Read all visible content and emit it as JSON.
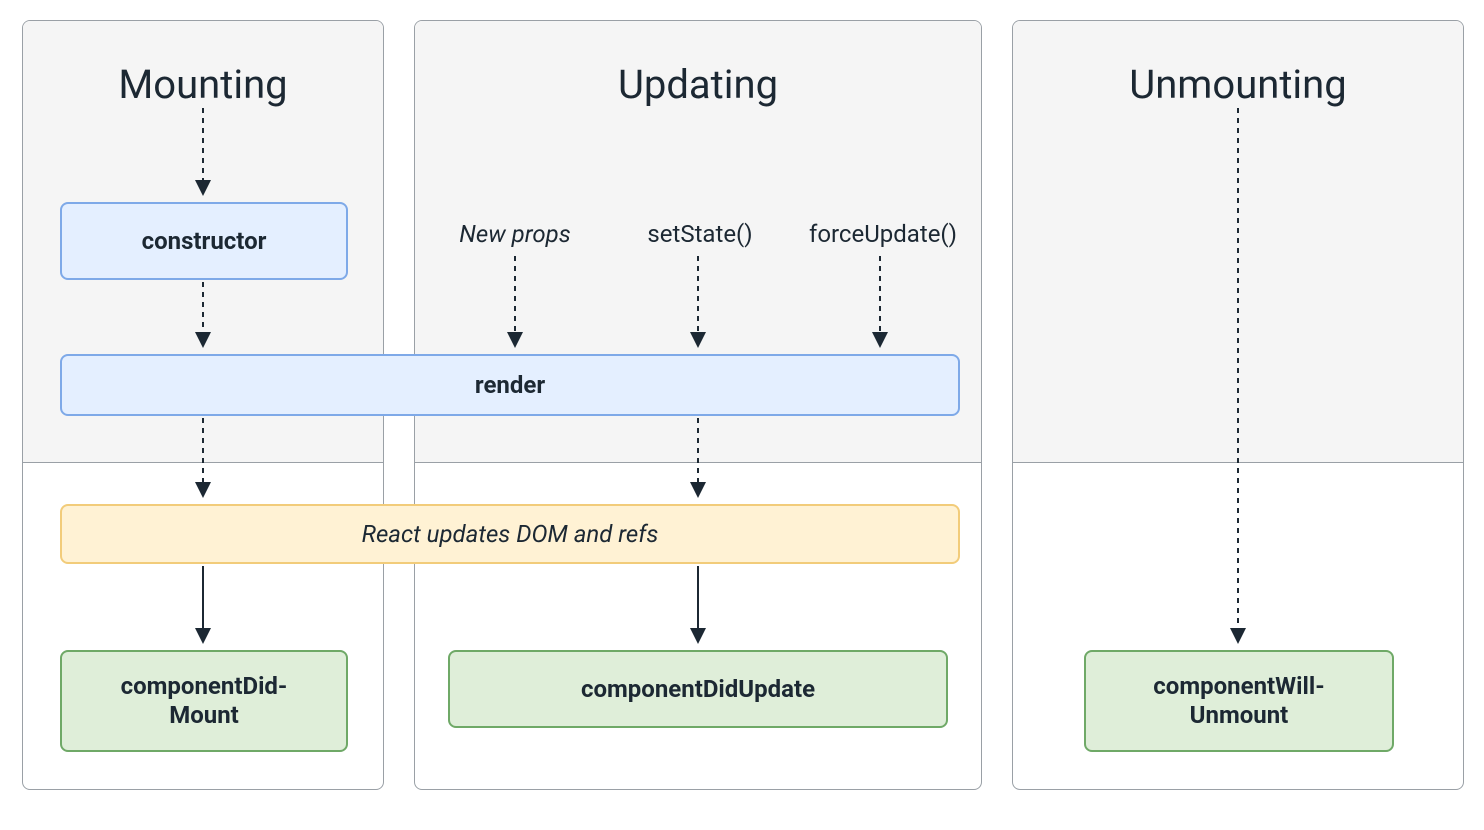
{
  "phases": {
    "mounting": {
      "title": "Mounting"
    },
    "updating": {
      "title": "Updating"
    },
    "unmounting": {
      "title": "Unmounting"
    }
  },
  "nodes": {
    "constructor": "constructor",
    "render": "render",
    "react_updates": "React updates DOM and refs",
    "componentDidMount": "componentDid-\nMount",
    "componentDidUpdate": "componentDidUpdate",
    "componentWillUnmount": "componentWill-\nUnmount"
  },
  "triggers": {
    "newProps": "New props",
    "setState": "setState()",
    "forceUpdate": "forceUpdate()"
  },
  "colors": {
    "blue_bg": "#e4efff",
    "blue_br": "#7ea9e8",
    "yellow_bg": "#fff2d4",
    "yellow_br": "#f2cc7a",
    "green_bg": "#dfeed9",
    "green_br": "#6fa967",
    "phase_bg": "#f5f5f5",
    "phase_br": "#9aa0a6",
    "text": "#1c2833"
  }
}
